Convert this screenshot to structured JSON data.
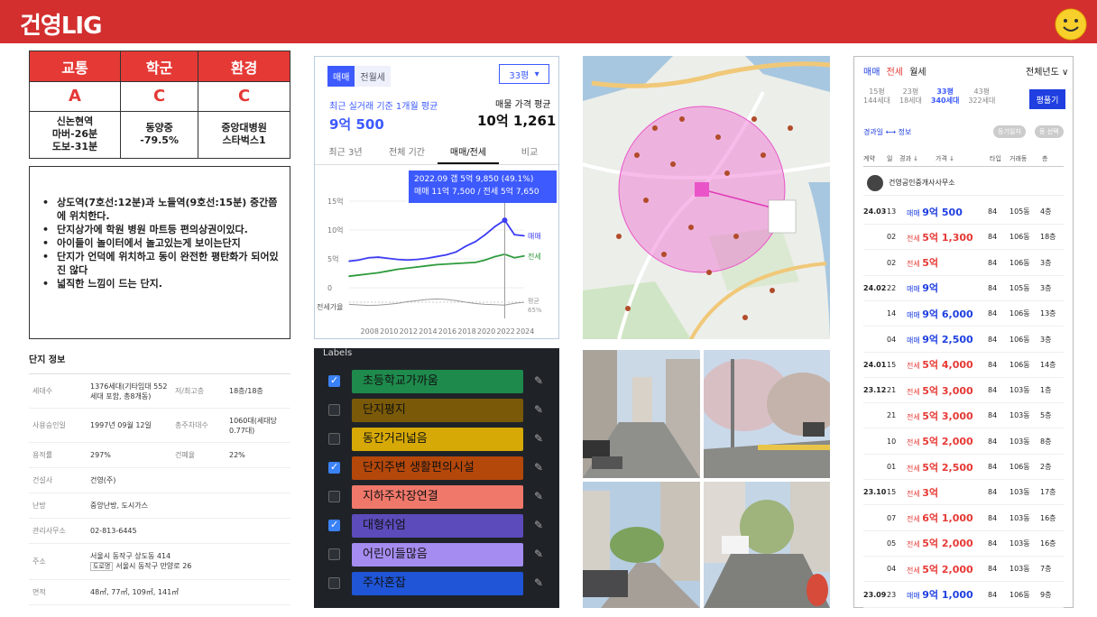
{
  "header": {
    "brand": "건영LIG"
  },
  "scores": {
    "categories": [
      {
        "title": "교통",
        "grade": "A",
        "line1": "신논현역",
        "line2": "마버-26분",
        "line3": "도보-31분"
      },
      {
        "title": "학군",
        "grade": "C",
        "line1": "동양중",
        "line2": "-79.5%",
        "line3": ""
      },
      {
        "title": "환경",
        "grade": "C",
        "line1": "중앙대병원",
        "line2": "스타벅스1",
        "line3": ""
      }
    ]
  },
  "description": [
    "상도역(7호선:12분)과 노들역(9호선:15분) 중간쯤에 위치한다.",
    "단지상가에 학원 병원 마트등 편의상권이있다.",
    "아이들이 놀이터에서 놀고있는게 보이는단지",
    "단지가 언덕에 위치하고 동이 완전한 평탄화가 되어있진 않다",
    "넓직한 느낌이 드는 단지."
  ],
  "complex_info": {
    "title": "단지 정보",
    "rows": [
      {
        "k": "세대수",
        "v": "1376세대(기타임대 552세대 포함, 총8개동)",
        "k2": "저/최고층",
        "v2": "18층/18층"
      },
      {
        "k": "사용승인일",
        "v": "1997년 09월 12일",
        "k2": "총주차대수",
        "v2": "1060대(세대당 0.77대)"
      },
      {
        "k": "용적률",
        "v": "297%",
        "k2": "건폐율",
        "v2": "22%"
      },
      {
        "k": "건설사",
        "v": "건영(주)",
        "k2": "",
        "v2": ""
      },
      {
        "k": "난방",
        "v": "중앙난방, 도시가스",
        "k2": "",
        "v2": ""
      },
      {
        "k": "관리사무소",
        "v": "02-813-6445",
        "k2": "",
        "v2": ""
      },
      {
        "k": "주소",
        "v": "서울시 동작구 상도동 414",
        "v_extra_tag": "도로명",
        "v_extra": "서울시 동작구 만양로 26",
        "k2": "",
        "v2": ""
      },
      {
        "k": "면적",
        "v": "48㎡, 77㎡, 109㎡, 141㎡",
        "k2": "",
        "v2": ""
      }
    ]
  },
  "price": {
    "toggle_on": "매매",
    "toggle_off": "전월세",
    "pyeong": "33평",
    "label_left": "최근 실거래 기준 1개월 평균",
    "value_left": "9억 500",
    "label_right": "매물 가격 평균",
    "value_right": "10억 1,261",
    "tabs": [
      "최근 3년",
      "전체 기간",
      "매매/전세",
      "비교"
    ],
    "active_tab": 2,
    "tooltip_line1": "2022.09 갭 5억 9,850 (49.1%)",
    "tooltip_line2": "매매 11억 7,500 / 전세 5억 7,650"
  },
  "chart_data": {
    "type": "line",
    "x": [
      2006,
      2007,
      2008,
      2009,
      2010,
      2011,
      2012,
      2013,
      2014,
      2015,
      2016,
      2017,
      2018,
      2019,
      2020,
      2021,
      2022,
      2023,
      2024
    ],
    "x_tick_labels": [
      "2008",
      "2010",
      "2012",
      "2014",
      "2016",
      "2018",
      "2020",
      "2022",
      "2024"
    ],
    "y_tick_labels": [
      "15억",
      "10억",
      "5억",
      "0"
    ],
    "ylim": [
      0,
      15
    ],
    "series": [
      {
        "name": "매매",
        "color": "#3d3df5",
        "values": [
          4.6,
          4.8,
          5.2,
          5.3,
          5.1,
          4.9,
          4.8,
          4.9,
          5.1,
          5.4,
          5.7,
          6.2,
          7.2,
          8.0,
          9.2,
          10.6,
          11.7,
          9.2,
          9.0
        ]
      },
      {
        "name": "전세",
        "color": "#2e9b3e",
        "values": [
          2.0,
          2.2,
          2.4,
          2.6,
          2.9,
          3.2,
          3.4,
          3.6,
          3.8,
          4.0,
          4.1,
          4.2,
          4.3,
          4.4,
          4.8,
          5.4,
          5.8,
          5.2,
          5.5
        ]
      }
    ],
    "bottom_label": "전세가율",
    "bottom_right_label": "평균",
    "bottom_right_value": "65%"
  },
  "labels": {
    "title": "Labels",
    "items": [
      {
        "text": "초등학교가까움",
        "color": "#1e8a4c",
        "checked": true
      },
      {
        "text": "단지평지",
        "color": "#7a5a08",
        "checked": false
      },
      {
        "text": "동간거리넓음",
        "color": "#d6a907",
        "checked": false
      },
      {
        "text": "단지주변 생활편의시설",
        "color": "#b4470a",
        "checked": true
      },
      {
        "text": "지하주차장연결",
        "color": "#f0786a",
        "checked": false
      },
      {
        "text": "대형쉬엄",
        "color": "#5b4bbb",
        "checked": true
      },
      {
        "text": "어린이들많음",
        "color": "#a58cf0",
        "checked": false
      },
      {
        "text": "주차혼잡",
        "color": "#1f55d6",
        "checked": false
      }
    ]
  },
  "transactions": {
    "tabs": [
      "매매",
      "전세",
      "월세"
    ],
    "year_label": "전체년도 ∨",
    "sizes": [
      {
        "py": "15평",
        "hh": "144세대"
      },
      {
        "py": "23평",
        "hh": "18세대"
      },
      {
        "py": "33평",
        "hh": "340세대"
      },
      {
        "py": "43평",
        "hh": "322세대"
      }
    ],
    "active_size": 2,
    "pyeong_btn": "평풀기",
    "sub_left": "경과일 ⟷ 정보",
    "chip1": "등기일자",
    "chip2": "동 선택",
    "head": [
      "계약",
      "일",
      "경과 ↓",
      "가격 ↓",
      "타입",
      "거래동",
      "층"
    ],
    "agent": "건영공인중개사사무소",
    "rows": [
      {
        "ym": "24.03",
        "d": "13",
        "kind": "매매",
        "price": "9억 500",
        "type": "84",
        "dong": "105동",
        "fl": "4층"
      },
      {
        "ym": "",
        "d": "02",
        "kind": "전세",
        "price": "5억 1,300",
        "type": "84",
        "dong": "106동",
        "fl": "18층"
      },
      {
        "ym": "",
        "d": "02",
        "kind": "전세",
        "price": "5억",
        "type": "84",
        "dong": "106동",
        "fl": "3층"
      },
      {
        "ym": "24.02",
        "d": "22",
        "kind": "매매",
        "price": "9억",
        "type": "84",
        "dong": "105동",
        "fl": "3층"
      },
      {
        "ym": "",
        "d": "14",
        "kind": "매매",
        "price": "9억 6,000",
        "type": "84",
        "dong": "106동",
        "fl": "13층"
      },
      {
        "ym": "",
        "d": "04",
        "kind": "매매",
        "price": "9억 2,500",
        "type": "84",
        "dong": "106동",
        "fl": "3층"
      },
      {
        "ym": "24.01",
        "d": "15",
        "kind": "전세",
        "price": "5억 4,000",
        "type": "84",
        "dong": "106동",
        "fl": "14층"
      },
      {
        "ym": "23.12",
        "d": "21",
        "kind": "전세",
        "price": "5억 3,000",
        "type": "84",
        "dong": "103동",
        "fl": "1층"
      },
      {
        "ym": "",
        "d": "21",
        "kind": "전세",
        "price": "5억 3,000",
        "type": "84",
        "dong": "103동",
        "fl": "5층"
      },
      {
        "ym": "",
        "d": "10",
        "kind": "전세",
        "price": "5억 2,000",
        "type": "84",
        "dong": "103동",
        "fl": "8층"
      },
      {
        "ym": "",
        "d": "01",
        "kind": "전세",
        "price": "5억 2,500",
        "type": "84",
        "dong": "106동",
        "fl": "2층"
      },
      {
        "ym": "23.10",
        "d": "15",
        "kind": "전세",
        "price": "3억",
        "type": "84",
        "dong": "103동",
        "fl": "17층"
      },
      {
        "ym": "",
        "d": "07",
        "kind": "전세",
        "price": "6억 1,000",
        "type": "84",
        "dong": "103동",
        "fl": "16층"
      },
      {
        "ym": "",
        "d": "05",
        "kind": "전세",
        "price": "5억 2,000",
        "type": "84",
        "dong": "103동",
        "fl": "16층"
      },
      {
        "ym": "",
        "d": "04",
        "kind": "전세",
        "price": "5억 2,000",
        "type": "84",
        "dong": "103동",
        "fl": "7층"
      },
      {
        "ym": "23.09",
        "d": "23",
        "kind": "매매",
        "price": "9억 1,000",
        "type": "84",
        "dong": "106동",
        "fl": "9층"
      }
    ]
  }
}
